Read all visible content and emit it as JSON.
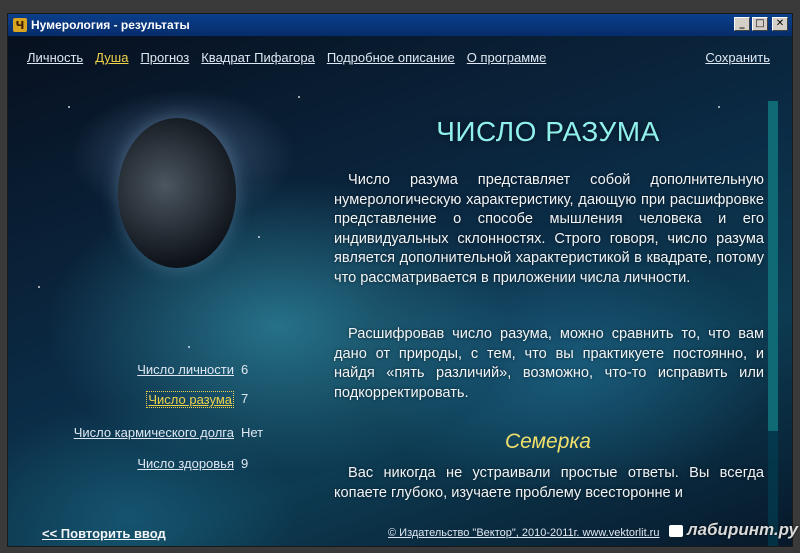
{
  "window": {
    "title": "Нумерология - результаты",
    "app_icon_glyph": "Ч",
    "minimize_glyph": "_",
    "maximize_glyph": "□",
    "close_glyph": "✕"
  },
  "topnav": {
    "items": [
      "Личность",
      "Душа",
      "Прогноз",
      "Квадрат Пифагора",
      "Подробное описание",
      "О программе"
    ],
    "active": "Душа",
    "save_label": "Сохранить"
  },
  "sidebar": {
    "items": [
      {
        "label": "Число личности",
        "value": "6"
      },
      {
        "label": "Число разума",
        "value": "7",
        "active": true
      },
      {
        "label": "Число кармического долга",
        "value": "Нет"
      },
      {
        "label": "Число здоровья",
        "value": "9"
      }
    ]
  },
  "main": {
    "heading": "ЧИСЛО РАЗУМА",
    "paragraph1": "Число разума представляет собой дополнительную нумерологическую характеристику, дающую при расшифровке представление о способе мышления человека и его индивидуальных склонностях. Строго говоря, число разума является дополнительной характеристикой в квадрате, потому что рассматривается в приложении числа личности.",
    "paragraph2": "Расшифровав число разума, можно сравнить то, что вам дано от природы, с тем, что вы практикуете постоянно, и найдя «пять различий», возможно, что-то исправить или подкорректировать.",
    "subheading": "Семерка",
    "paragraph3": "Вас никогда не устраивали простые ответы. Вы всегда копаете глубоко, изучаете проблему всесторонне и"
  },
  "footer": {
    "back_label": "<< Повторить ввод",
    "copyright": "© Издательство \"Вектор\", 2010-2011г. www.vektorlit.ru"
  },
  "watermark": "лабиринт.ру",
  "colors": {
    "heading": "#8ff0ec",
    "active_link": "#f0d24a",
    "subheading": "#f0e06a",
    "titlebar": "#0a3f8c"
  }
}
